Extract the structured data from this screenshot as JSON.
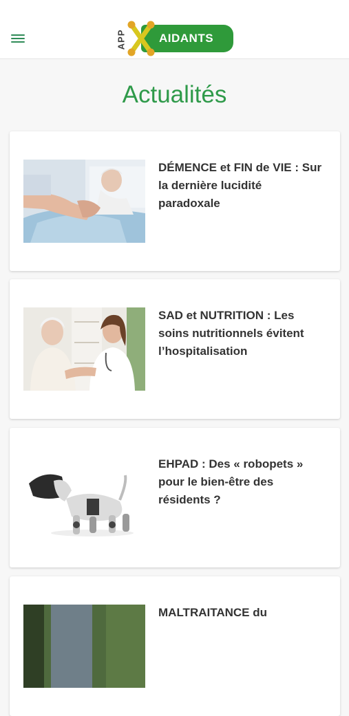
{
  "header": {
    "menu_icon": "hamburger-menu-icon",
    "logo": {
      "app": "APP",
      "name": "AIDANTS"
    }
  },
  "page": {
    "title": "Actualités"
  },
  "articles": [
    {
      "title": "DÉMENCE et FIN de VIE : Sur la dernière lucidité paradoxale",
      "image": "elderly-patient-hand-holding-photo"
    },
    {
      "title": "SAD et NUTRITION : Les soins nutritionnels évitent l’hospitalisation",
      "image": "doctor-with-elderly-woman-photo"
    },
    {
      "title": "EHPAD : Des « robopets » pour le bien-être des résidents ?",
      "image": "robot-dog-photo"
    },
    {
      "title": "MALTRAITANCE du",
      "image": "outdoor-people-photo"
    }
  ],
  "colors": {
    "brand_green": "#2f9a3a",
    "title_green": "#2f9a4a",
    "text": "#333333"
  }
}
